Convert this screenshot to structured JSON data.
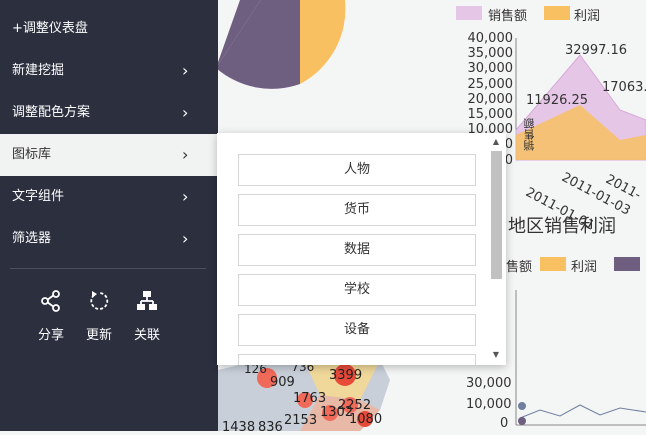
{
  "background": {
    "legend_top": {
      "sales": "销售额",
      "profit": "利润"
    },
    "y_ticks": [
      "40,000",
      "35,000",
      "30,000",
      "25,000",
      "20,000",
      "15,000",
      "10,000",
      "5,000",
      "0"
    ],
    "values": {
      "v1": "32997.16",
      "v2": "11926.25",
      "v3": "17063."
    },
    "y_axis_title": "销售额",
    "x_ticks": [
      "2011-01-01",
      "2011-01-03",
      "2011-"
    ],
    "chart2_title": "地区销售利润",
    "legend2": {
      "sales": "售额",
      "profit": "利润"
    },
    "y2_ticks": [
      "30,000",
      "10,000",
      "0"
    ],
    "map_labels": [
      "3399",
      "126",
      "909",
      "1763",
      "2252",
      "1302",
      "2153",
      "1080",
      "1438",
      "836",
      " 736"
    ]
  },
  "sidebar": {
    "items": [
      {
        "label": "+调整仪表盘",
        "chevron": ""
      },
      {
        "label": "新建挖掘",
        "chevron": "›"
      },
      {
        "label": "调整配色方案",
        "chevron": "›"
      },
      {
        "label": "图标库",
        "chevron": "›"
      },
      {
        "label": "文字组件",
        "chevron": "›"
      },
      {
        "label": "筛选器",
        "chevron": "›"
      }
    ],
    "actions": [
      {
        "label": "分享",
        "icon": "share-icon"
      },
      {
        "label": "更新",
        "icon": "refresh-icon"
      },
      {
        "label": "关联",
        "icon": "link-icon"
      }
    ]
  },
  "icon_library": {
    "buttons": [
      "人物",
      "货币",
      "数据",
      "学校",
      "设备"
    ],
    "scroll_up": "▲",
    "scroll_down": "▼"
  }
}
